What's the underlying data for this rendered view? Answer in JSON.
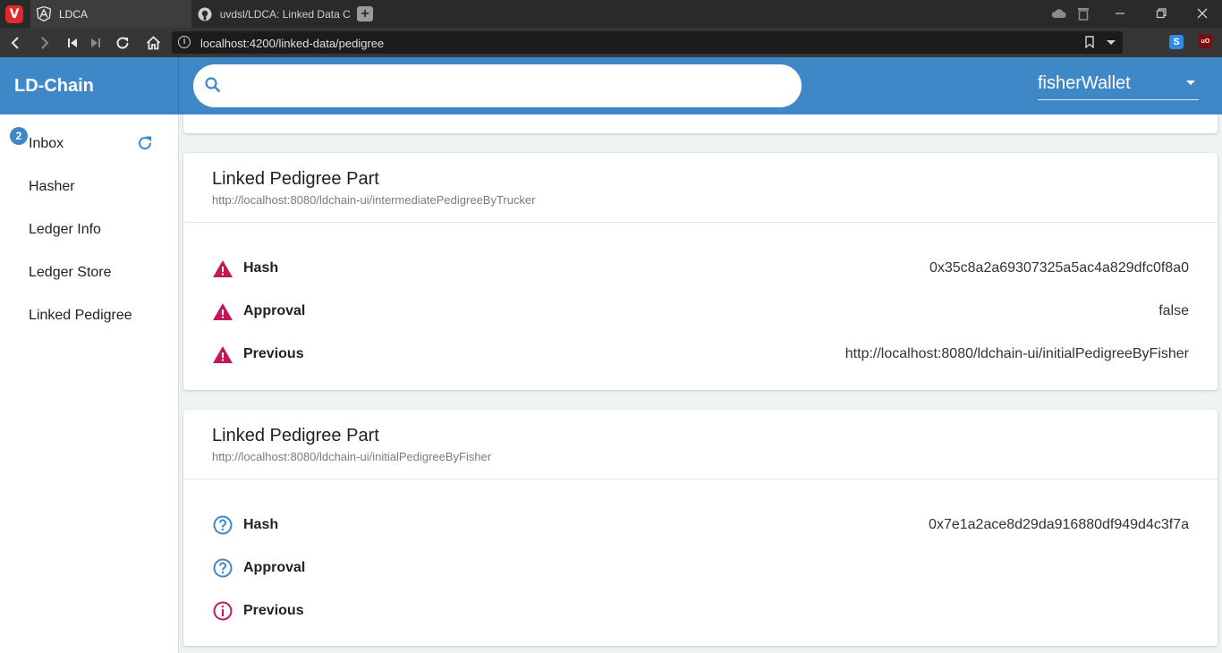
{
  "browser": {
    "tabs": [
      {
        "title": "LDCA",
        "active": true
      },
      {
        "title": "uvdsl/LDCA: Linked Data Cł",
        "active": false
      }
    ],
    "url": "localhost:4200/linked-data/pedigree",
    "vivaldi_glyph": "V",
    "ext_s_glyph": "S",
    "ext_ub_glyph": "uO"
  },
  "app": {
    "brand": "LD-Chain",
    "search": {
      "placeholder": "",
      "value": ""
    },
    "wallet": {
      "selected": "fisherWallet"
    }
  },
  "sidebar": {
    "inbox": {
      "label": "Inbox",
      "badge": "2"
    },
    "items": [
      {
        "label": "Hasher"
      },
      {
        "label": "Ledger Info"
      },
      {
        "label": "Ledger Store"
      },
      {
        "label": "Linked Pedigree"
      }
    ]
  },
  "cards": [
    {
      "title": "Linked Pedigree Part",
      "subtitle": "http://localhost:8080/ldchain-ui/intermediatePedigreeByTrucker",
      "rows": [
        {
          "label": "Hash",
          "value": "0x35c8a2a69307325a5ac4a829dfc0f8a0",
          "icon": "warning-icon"
        },
        {
          "label": "Approval",
          "value": "false",
          "icon": "warning-icon"
        },
        {
          "label": "Previous",
          "value": "http://localhost:8080/ldchain-ui/initialPedigreeByFisher",
          "icon": "warning-icon"
        }
      ]
    },
    {
      "title": "Linked Pedigree Part",
      "subtitle": "http://localhost:8080/ldchain-ui/initialPedigreeByFisher",
      "rows": [
        {
          "label": "Hash",
          "value": "0x7e1a2ace8d29da916880df949d4c3f7a",
          "icon": "help-icon"
        },
        {
          "label": "Approval",
          "value": "",
          "icon": "help-icon"
        },
        {
          "label": "Previous",
          "value": "",
          "icon": "info-icon"
        }
      ]
    }
  ],
  "colors": {
    "primary": "#3f88c8",
    "warning": "#c2185b",
    "help": "#3f88c8",
    "info": "#c2185b"
  }
}
